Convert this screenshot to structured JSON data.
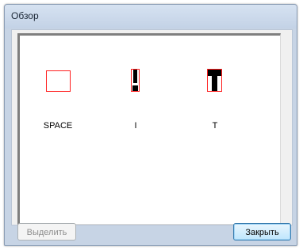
{
  "window": {
    "title": "Обзор"
  },
  "preview": {
    "glyphs": [
      {
        "label": "SPACE"
      },
      {
        "label": "I"
      },
      {
        "label": "T"
      }
    ]
  },
  "buttons": {
    "select_label": "Выделить",
    "select_enabled": false,
    "close_label": "Закрыть"
  },
  "colors": {
    "glyph_box": "#ff1f1f",
    "glyph_fill": "#000000",
    "window_frame": "#c7d4e5",
    "default_button_border": "#3c7fb1"
  }
}
